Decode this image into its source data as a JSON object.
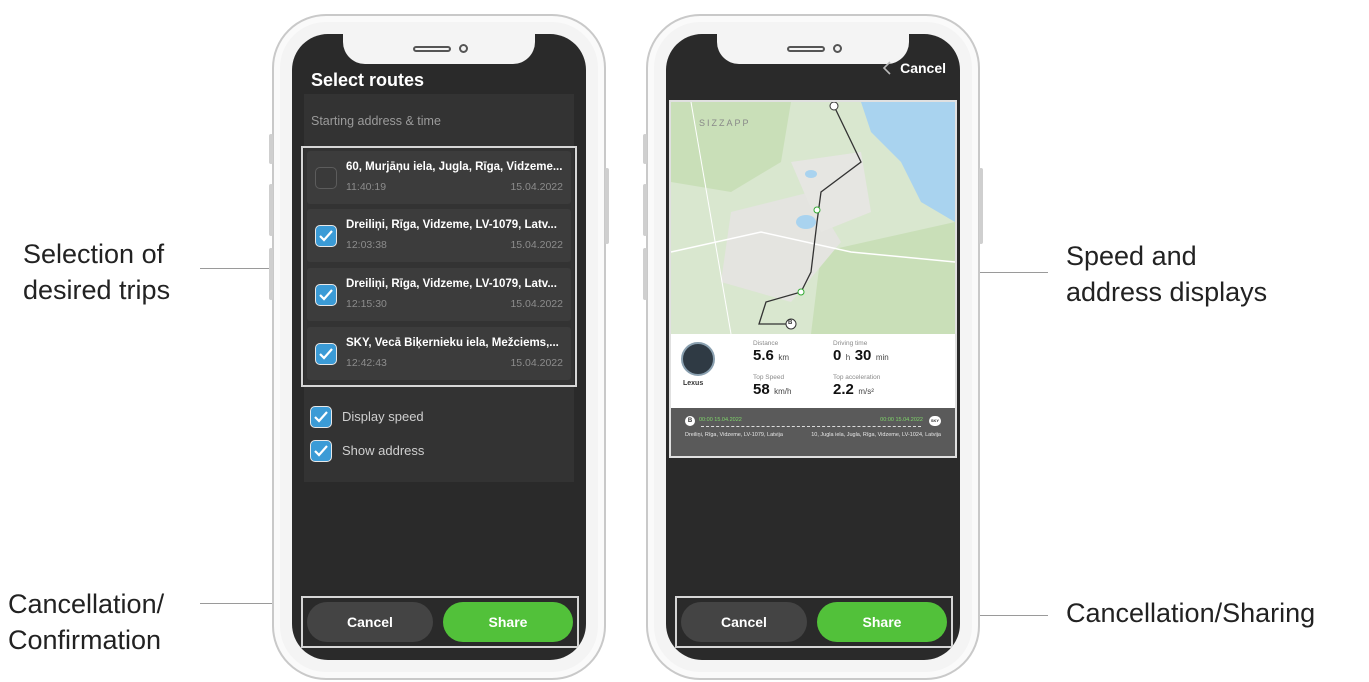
{
  "callouts": {
    "selection": [
      "Selection of",
      "desired trips"
    ],
    "cancel_confirm": [
      "Cancellation/",
      "Confirmation"
    ],
    "speed_address": [
      "Speed and",
      "address displays"
    ],
    "cancel_share": "Cancellation/Sharing"
  },
  "left_screen": {
    "title": "Select routes",
    "subtitle": "Starting address & time",
    "routes": [
      {
        "address": "60, Murjāņu iela, Jugla, Rīga, Vidzeme...",
        "time": "11:40:19",
        "date": "15.04.2022",
        "checked": false
      },
      {
        "address": "Dreiliņi, Rīga, Vidzeme, LV-1079, Latv...",
        "time": "12:03:38",
        "date": "15.04.2022",
        "checked": true
      },
      {
        "address": "Dreiliņi, Rīga, Vidzeme, LV-1079, Latv...",
        "time": "12:15:30",
        "date": "15.04.2022",
        "checked": true
      },
      {
        "address": "SKY, Vecā Biķernieku iela, Mežciems,...",
        "time": "12:42:43",
        "date": "15.04.2022",
        "checked": true
      }
    ],
    "options": {
      "display_speed": "Display speed",
      "show_address": "Show address"
    },
    "buttons": {
      "cancel": "Cancel",
      "share": "Share"
    }
  },
  "right_screen": {
    "back_label": "Cancel",
    "map": {
      "brand": "SIZZAPP",
      "start_marker": "B"
    },
    "vehicle_name": "Lexus",
    "stats": {
      "distance_label": "Distance",
      "distance_value": "5.6",
      "distance_unit": "km",
      "driving_time_label": "Driving time",
      "driving_hours": "0",
      "hours_unit": "h",
      "driving_minutes": "30",
      "minutes_unit": "min",
      "top_speed_label": "Top Speed",
      "top_speed_value": "58",
      "top_speed_unit": "km/h",
      "top_accel_label": "Top acceleration",
      "top_accel_value": "2.2",
      "top_accel_unit": "m/s²"
    },
    "trip_strip": {
      "start_time": "00:00 15.04.2022",
      "end_time": "00:00 15.04.2022",
      "start_address": "Dreiliņi, Rīga, Vidzeme, LV-1079, Latvija",
      "end_address": "10, Jugla iela, Jugla, Rīga, Vidzeme, LV-1024, Latvija",
      "start_marker": "B",
      "end_marker": "SKY"
    },
    "buttons": {
      "cancel": "Cancel",
      "share": "Share"
    }
  },
  "colors": {
    "accent_green": "#52c13a",
    "checkbox_blue": "#3b9bd6",
    "screen_bg": "#2a2a2a",
    "map_green": "#dbe9d2",
    "map_water": "#a9d3ef"
  }
}
